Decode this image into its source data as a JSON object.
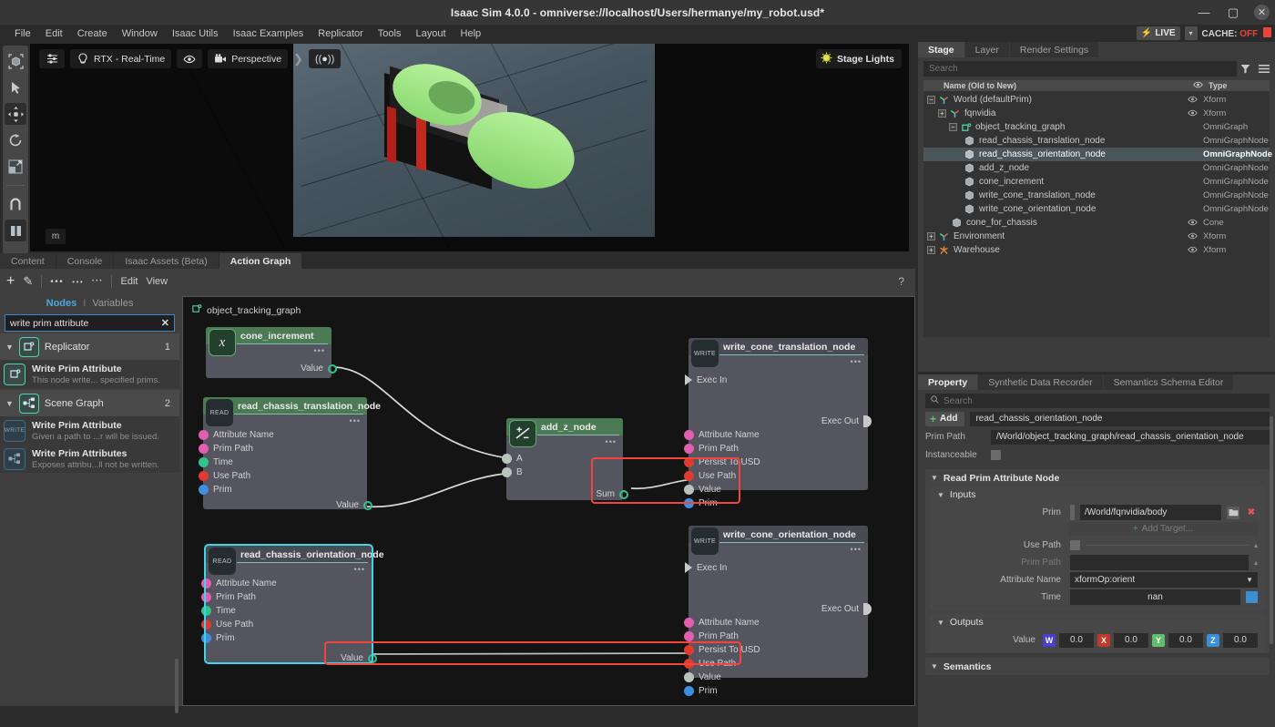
{
  "window": {
    "title": "Isaac Sim 4.0.0 - omniverse://localhost/Users/hermanye/my_robot.usd*",
    "minimize": "—",
    "maximize": "▢",
    "close": "✕"
  },
  "menubar": {
    "items": [
      "File",
      "Edit",
      "Create",
      "Window",
      "Isaac Utils",
      "Isaac Examples",
      "Replicator",
      "Tools",
      "Layout",
      "Help"
    ],
    "live_label": "LIVE",
    "live_caret": "▾",
    "cache_label": "CACHE:",
    "cache_state": "OFF"
  },
  "left_toolbar": {
    "items": [
      {
        "name": "select-box-tool",
        "glyph": "⬚"
      },
      {
        "name": "select-arrow-tool",
        "glyph": "➤"
      },
      {
        "name": "move-tool",
        "glyph": "✛"
      },
      {
        "name": "rotate-tool",
        "glyph": "↻"
      },
      {
        "name": "scale-tool",
        "glyph": "↗"
      },
      {
        "name": "snap-magnet-tool",
        "glyph": "∩"
      },
      {
        "name": "pause-tool",
        "glyph": "❙❙"
      }
    ]
  },
  "viewport": {
    "render_mode": "RTX - Real-Time",
    "camera": "Perspective",
    "stage_lights": "Stage Lights",
    "unit_badge": "m"
  },
  "bottom_tabs": {
    "items": [
      "Content",
      "Console",
      "Isaac Assets (Beta)",
      "Action Graph"
    ],
    "active": "Action Graph"
  },
  "action_graph_toolbar": {
    "add": "+",
    "edit_pencil": "✎",
    "edit_label": "Edit",
    "view_label": "View",
    "help": "?"
  },
  "node_browser": {
    "tab_nodes": "Nodes",
    "tab_divider": "I",
    "tab_variables": "Variables",
    "search_value": "write prim attribute",
    "clear": "✕",
    "groups": [
      {
        "name": "Replicator",
        "count": "1",
        "icon": "replicator-icon",
        "items": [
          {
            "title": "Write Prim Attribute",
            "desc": "This node write... specified prims.",
            "icon_kind": "teal",
            "icon_text": ""
          }
        ]
      },
      {
        "name": "Scene Graph",
        "count": "2",
        "icon": "scene-graph-icon",
        "items": [
          {
            "title": "Write Prim Attribute",
            "desc": "Given a path to ...r will be issued.",
            "icon_kind": "blue",
            "icon_text": "WRITE"
          },
          {
            "title": "Write Prim Attributes",
            "desc": "Exposes attribu...ll not be written.",
            "icon_kind": "blue",
            "icon_text": ""
          }
        ]
      }
    ]
  },
  "graph": {
    "title": "object_tracking_graph",
    "nodes": [
      {
        "id": "cone_increment",
        "title": "cone_increment",
        "badge": "𝑥",
        "badge_kind": "green",
        "header_kind": "green",
        "dots": "•••",
        "inputs": [],
        "outputs": [
          "Value"
        ]
      },
      {
        "id": "read_chassis_translation_node",
        "title": "read_chassis_translation_node",
        "badge": "READ",
        "badge_kind": "grey",
        "header_kind": "green",
        "dots": "•••",
        "inputs": [
          "Attribute Name",
          "Prim Path",
          "Time",
          "Use Path",
          "Prim"
        ],
        "outputs": [
          "Value"
        ]
      },
      {
        "id": "add_z_node",
        "title": "add_z_node",
        "badge": "+/-",
        "badge_kind": "green",
        "header_kind": "green",
        "dots": "•••",
        "inputs": [
          "A",
          "B"
        ],
        "outputs": [
          "Sum"
        ]
      },
      {
        "id": "write_cone_translation_node",
        "title": "write_cone_translation_node",
        "badge": "WRITE",
        "badge_kind": "grey",
        "header_kind": "grey",
        "dots": "•••",
        "inputs": [
          "Exec In",
          "Attribute Name",
          "Prim Path",
          "Persist To USD",
          "Use Path",
          "Value",
          "Prim"
        ],
        "outputs": [
          "Exec Out"
        ]
      },
      {
        "id": "read_chassis_orientation_node",
        "title": "read_chassis_orientation_node",
        "badge": "READ",
        "badge_kind": "grey",
        "header_kind": "grey",
        "dots": "•••",
        "selected": true,
        "inputs": [
          "Attribute Name",
          "Prim Path",
          "Time",
          "Use Path",
          "Prim"
        ],
        "outputs": [
          "Value"
        ]
      },
      {
        "id": "write_cone_orientation_node",
        "title": "write_cone_orientation_node",
        "badge": "WRITE",
        "badge_kind": "grey",
        "header_kind": "grey",
        "dots": "•••",
        "inputs": [
          "Exec In",
          "Attribute Name",
          "Prim Path",
          "Persist To USD",
          "Use Path",
          "Value",
          "Prim"
        ],
        "outputs": [
          "Exec Out"
        ]
      }
    ],
    "highlight_color": "#f2453d",
    "selection_color": "#3fd5e8"
  },
  "stage": {
    "tabs": [
      "Stage",
      "Layer",
      "Render Settings"
    ],
    "active_tab": "Stage",
    "search_placeholder": "Search",
    "columns": {
      "name": "Name (Old to New)",
      "visibility": "👁",
      "type": "Type"
    },
    "rows": [
      {
        "label": "World (defaultPrim)",
        "type": "Xform",
        "indent": 0,
        "expander": "−",
        "icon": "xform-axis-icon",
        "eye": true
      },
      {
        "label": "fqnvidia",
        "type": "Xform",
        "indent": 1,
        "expander": "+",
        "icon": "xform-axis-icon",
        "eye": true
      },
      {
        "label": "object_tracking_graph",
        "type": "OmniGraph",
        "indent": 2,
        "expander": "−",
        "icon": "omnigraph-icon",
        "eye": false
      },
      {
        "label": "read_chassis_translation_node",
        "type": "OmniGraphNode",
        "indent": 3,
        "expander": "",
        "icon": "node-cube-icon",
        "eye": false
      },
      {
        "label": "read_chassis_orientation_node",
        "type": "OmniGraphNode",
        "indent": 3,
        "expander": "",
        "icon": "node-cube-icon",
        "eye": false,
        "selected": true
      },
      {
        "label": "add_z_node",
        "type": "OmniGraphNode",
        "indent": 3,
        "expander": "",
        "icon": "node-cube-icon",
        "eye": false
      },
      {
        "label": "cone_increment",
        "type": "OmniGraphNode",
        "indent": 3,
        "expander": "",
        "icon": "node-cube-icon",
        "eye": false
      },
      {
        "label": "write_cone_translation_node",
        "type": "OmniGraphNode",
        "indent": 3,
        "expander": "",
        "icon": "node-cube-icon",
        "eye": false
      },
      {
        "label": "write_cone_orientation_node",
        "type": "OmniGraphNode",
        "indent": 3,
        "expander": "",
        "icon": "node-cube-icon",
        "eye": false
      },
      {
        "label": "cone_for_chassis",
        "type": "Cone",
        "indent": 2,
        "expander": "",
        "icon": "node-cube-icon",
        "eye": true
      },
      {
        "label": "Environment",
        "type": "Xform",
        "indent": 0,
        "expander": "+",
        "icon": "xform-axis-icon",
        "eye": true
      },
      {
        "label": "Warehouse",
        "type": "Xform",
        "indent": 0,
        "expander": "+",
        "icon": "warehouse-icon",
        "eye": true
      }
    ]
  },
  "property": {
    "tabs": [
      "Property",
      "Synthetic Data Recorder",
      "Semantics Schema Editor"
    ],
    "active_tab": "Property",
    "search_placeholder": "Search",
    "add_label": "Add",
    "name_value": "read_chassis_orientation_node",
    "prim_path_label": "Prim Path",
    "prim_path_value": "/World/object_tracking_graph/read_chassis_orientation_node",
    "instanceable_label": "Instanceable",
    "section_title": "Read Prim Attribute Node",
    "inputs_title": "Inputs",
    "outputs_title": "Outputs",
    "semantics_title": "Semantics",
    "fields": {
      "prim_label": "Prim",
      "prim_value": "/World/fqnvidia/body",
      "add_target": "Add Target...",
      "use_path_label": "Use Path",
      "prim_path2_label": "Prim Path",
      "prim_path2_value": "",
      "attribute_name_label": "Attribute Name",
      "attribute_name_value": "xformOp:orient",
      "time_label": "Time",
      "time_value": "nan"
    },
    "outputs": {
      "value_label": "Value",
      "components": [
        {
          "axis": "W",
          "value": "0.0"
        },
        {
          "axis": "X",
          "value": "0.0"
        },
        {
          "axis": "Y",
          "value": "0.0"
        },
        {
          "axis": "Z",
          "value": "0.0"
        }
      ]
    }
  }
}
